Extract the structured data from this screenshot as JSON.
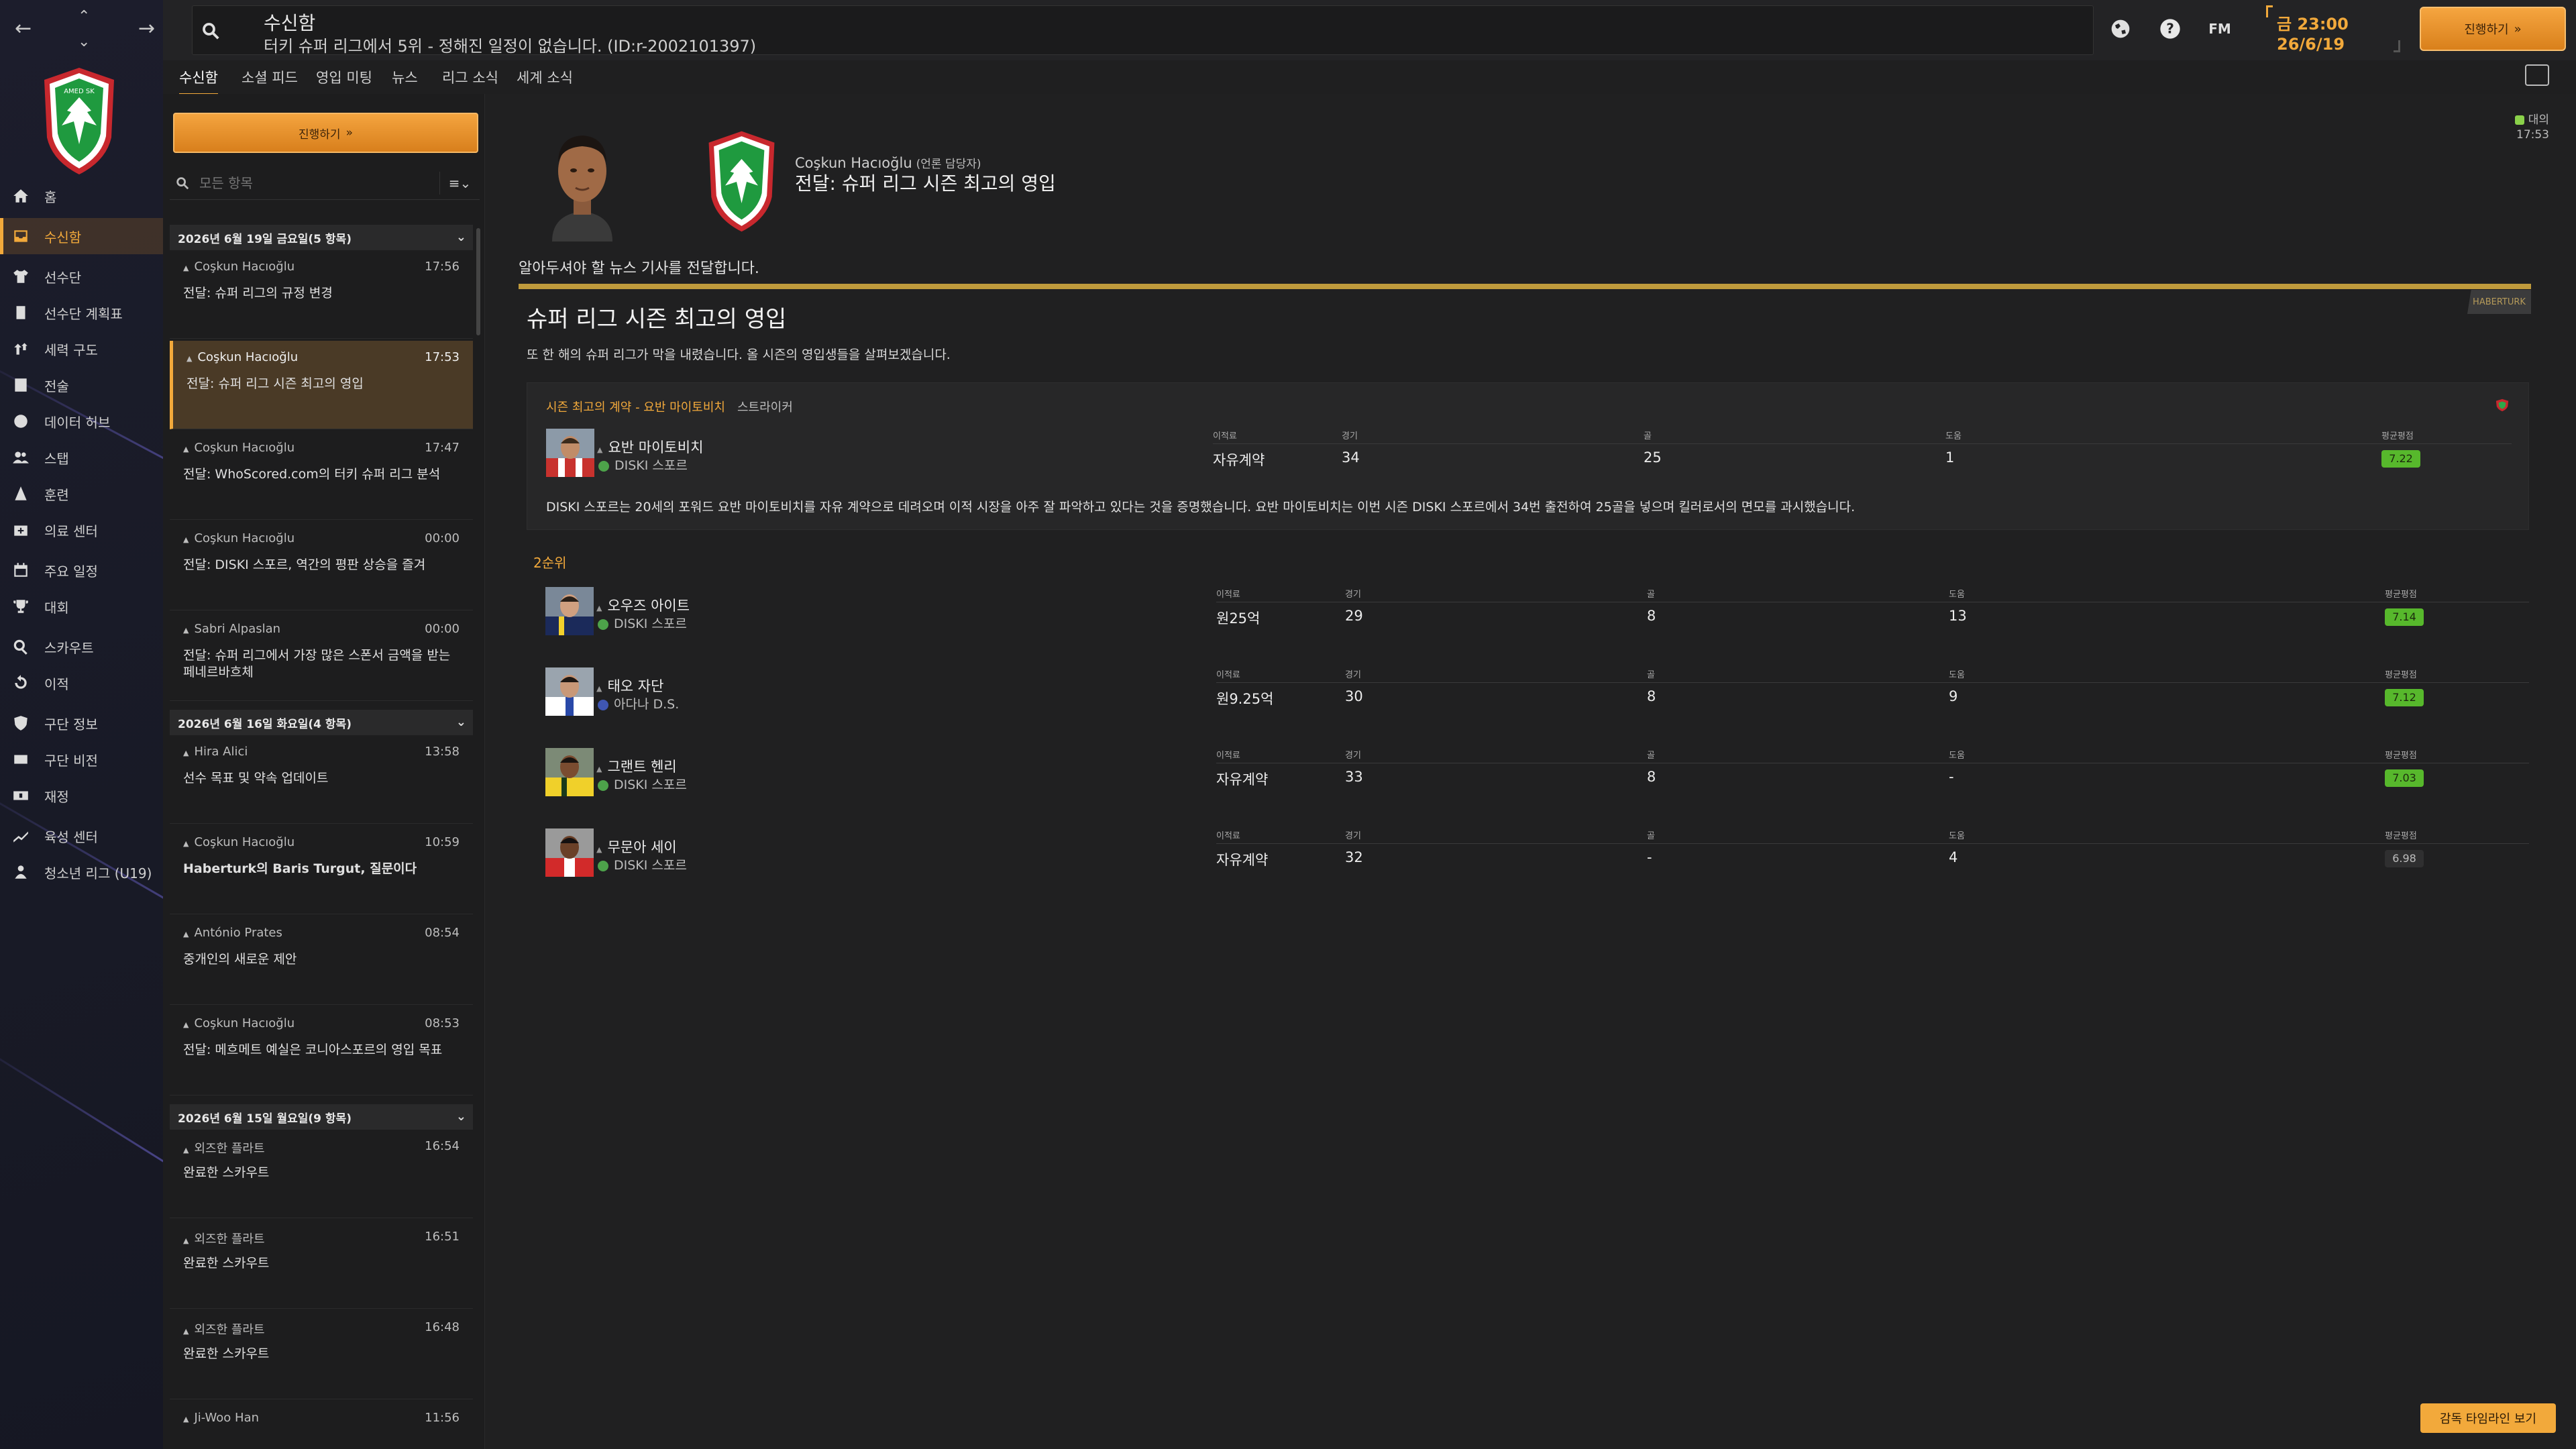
{
  "header": {
    "title": "수신함",
    "subtitle": "터키 슈퍼 리그에서 5위 - 정해진 일정이 없습니다. (ID:r-2002101397)",
    "time": "금 23:00",
    "date": "26/6/19",
    "continue_label": "진행하기",
    "fm_label": "FM"
  },
  "tabs": [
    "수신함",
    "소셜 피드",
    "영입 미팅",
    "뉴스",
    "리그 소식",
    "세계 소식"
  ],
  "nav": [
    {
      "label": "홈",
      "icon": "home-icon"
    },
    {
      "label": "수신함",
      "icon": "inbox-icon"
    },
    {
      "label": "선수단",
      "icon": "squad-icon"
    },
    {
      "label": "선수단 계획표",
      "icon": "clipboard-icon"
    },
    {
      "label": "세력 구도",
      "icon": "dynamics-icon"
    },
    {
      "label": "전술",
      "icon": "tactics-icon"
    },
    {
      "label": "데이터 허브",
      "icon": "data-hub-icon"
    },
    {
      "label": "스탭",
      "icon": "staff-icon"
    },
    {
      "label": "훈련",
      "icon": "training-icon"
    },
    {
      "label": "의료 센터",
      "icon": "medical-icon"
    },
    {
      "label": "주요 일정",
      "icon": "calendar-icon"
    },
    {
      "label": "대회",
      "icon": "trophy-icon"
    },
    {
      "label": "스카우트",
      "icon": "scouting-icon"
    },
    {
      "label": "이적",
      "icon": "transfers-icon"
    },
    {
      "label": "구단 정보",
      "icon": "club-info-icon"
    },
    {
      "label": "구단 비전",
      "icon": "vision-icon"
    },
    {
      "label": "재정",
      "icon": "finances-icon"
    },
    {
      "label": "육성 센터",
      "icon": "development-icon"
    },
    {
      "label": "청소년 리그 (U19)",
      "icon": "youth-icon"
    }
  ],
  "inbox": {
    "continue_label": "진행하기",
    "filter_placeholder": "모든 항목",
    "groups": [
      {
        "label": "2026년 6월 19일 금요일(5 항목)",
        "messages": [
          {
            "sender": "Coşkun Hacıoğlu",
            "time": "17:56",
            "subject": "전달: 슈퍼 리그의 규정 변경"
          },
          {
            "sender": "Coşkun Hacıoğlu",
            "time": "17:53",
            "subject": "전달: 슈퍼 리그 시즌 최고의 영입",
            "selected": true
          },
          {
            "sender": "Coşkun Hacıoğlu",
            "time": "17:47",
            "subject": "전달: WhoScored.com의 터키 슈퍼 리그 분석"
          },
          {
            "sender": "Coşkun Hacıoğlu",
            "time": "00:00",
            "subject": "전달: DISKI 스포르, 역간의 평판 상승을 즐겨"
          },
          {
            "sender": "Sabri Alpaslan",
            "time": "00:00",
            "subject": "전달: 슈퍼 리그에서 가장 많은 스폰서 금액을 받는 페네르바흐체"
          }
        ]
      },
      {
        "label": "2026년 6월 16일 화요일(4 항목)",
        "messages": [
          {
            "sender": "Hira Alici",
            "time": "13:58",
            "subject": "선수 목표 및 약속 업데이트"
          },
          {
            "sender": "Coşkun Hacıoğlu",
            "time": "10:59",
            "subject": "Haberturk의 Baris Turgut, 질문이다"
          },
          {
            "sender": "António Prates",
            "time": "08:54",
            "subject": "중개인의 새로운 제안"
          },
          {
            "sender": "Coşkun Hacıoğlu",
            "time": "08:53",
            "subject": "전달: 메흐메트 예실은 코니아스포르의 영입 목표"
          }
        ]
      },
      {
        "label": "2026년 6월 15일 월요일(9 항목)",
        "messages": [
          {
            "sender": "외즈한 플라트",
            "time": "16:54",
            "subject": "완료한 스카우트"
          },
          {
            "sender": "외즈한 플라트",
            "time": "16:51",
            "subject": "완료한 스카우트"
          },
          {
            "sender": "외즈한 플라트",
            "time": "16:48",
            "subject": "완료한 스카우트"
          },
          {
            "sender": "Ji-Woo Han",
            "time": "11:56",
            "subject": ""
          }
        ]
      }
    ]
  },
  "message": {
    "sender": "Coşkun Hacıoğlu",
    "sender_role": "(언론 담당자)",
    "title": "전달: 슈퍼 리그 시즌 최고의 영입",
    "badge_label": "대의",
    "badge_time": "17:53",
    "intro": "알아두셔야 할 뉴스 기사를 전달합니다.",
    "source": "HABERTURK",
    "article_title": "슈퍼 리그 시즌 최고의 영입",
    "article_sub": "또 한 해의 슈퍼 리그가 막을 내렸습니다. 올 시즌의 영입생들을 살펴보겠습니다.",
    "best_header": "시즌 최고의 계약 - 요반 마이토비치",
    "best_position": "스트라이커",
    "best_desc": "DISKI 스포르는 20세의 포워드 요반 마이토비치를 자유 계약으로 데려오며 이적 시장을 아주 잘 파악하고 있다는 것을 증명했습니다. 요반 마이토비치는 이번 시즌 DISKI 스포르에서 34번 출전하여 25골을 넣으며 킬러로서의 면모를 과시했습니다.",
    "second_label": "2순위",
    "col_labels": {
      "fee": "이적료",
      "apps": "경기",
      "goals": "골",
      "assists": "도움",
      "rating": "평균평점"
    },
    "best": {
      "name": "요반 마이토비치",
      "club": "DISKI 스포르",
      "fee": "자유계약",
      "apps": "34",
      "goals": "25",
      "assists": "1",
      "rating": "7.22"
    },
    "others": [
      {
        "name": "오우즈 아이트",
        "club": "DISKI 스포르",
        "fee": "원25억",
        "apps": "29",
        "goals": "8",
        "assists": "13",
        "rating": "7.14",
        "club_color": "green"
      },
      {
        "name": "태오 자단",
        "club": "아다나 D.S.",
        "fee": "원9.25억",
        "apps": "30",
        "goals": "8",
        "assists": "9",
        "rating": "7.12",
        "club_color": "blue"
      },
      {
        "name": "그랜트 헨리",
        "club": "DISKI 스포르",
        "fee": "자유계약",
        "apps": "33",
        "goals": "8",
        "assists": "-",
        "rating": "7.03",
        "club_color": "green"
      },
      {
        "name": "무문아 세이",
        "club": "DISKI 스포르",
        "fee": "자유계약",
        "apps": "32",
        "goals": "-",
        "assists": "4",
        "rating": "6.98",
        "club_color": "green"
      }
    ]
  },
  "timeline_button": "감독 타임라인 보기",
  "colors": {
    "accent": "#f2a93b",
    "rating_green": "#57b82c",
    "nav_bg": "#1a1b29"
  }
}
